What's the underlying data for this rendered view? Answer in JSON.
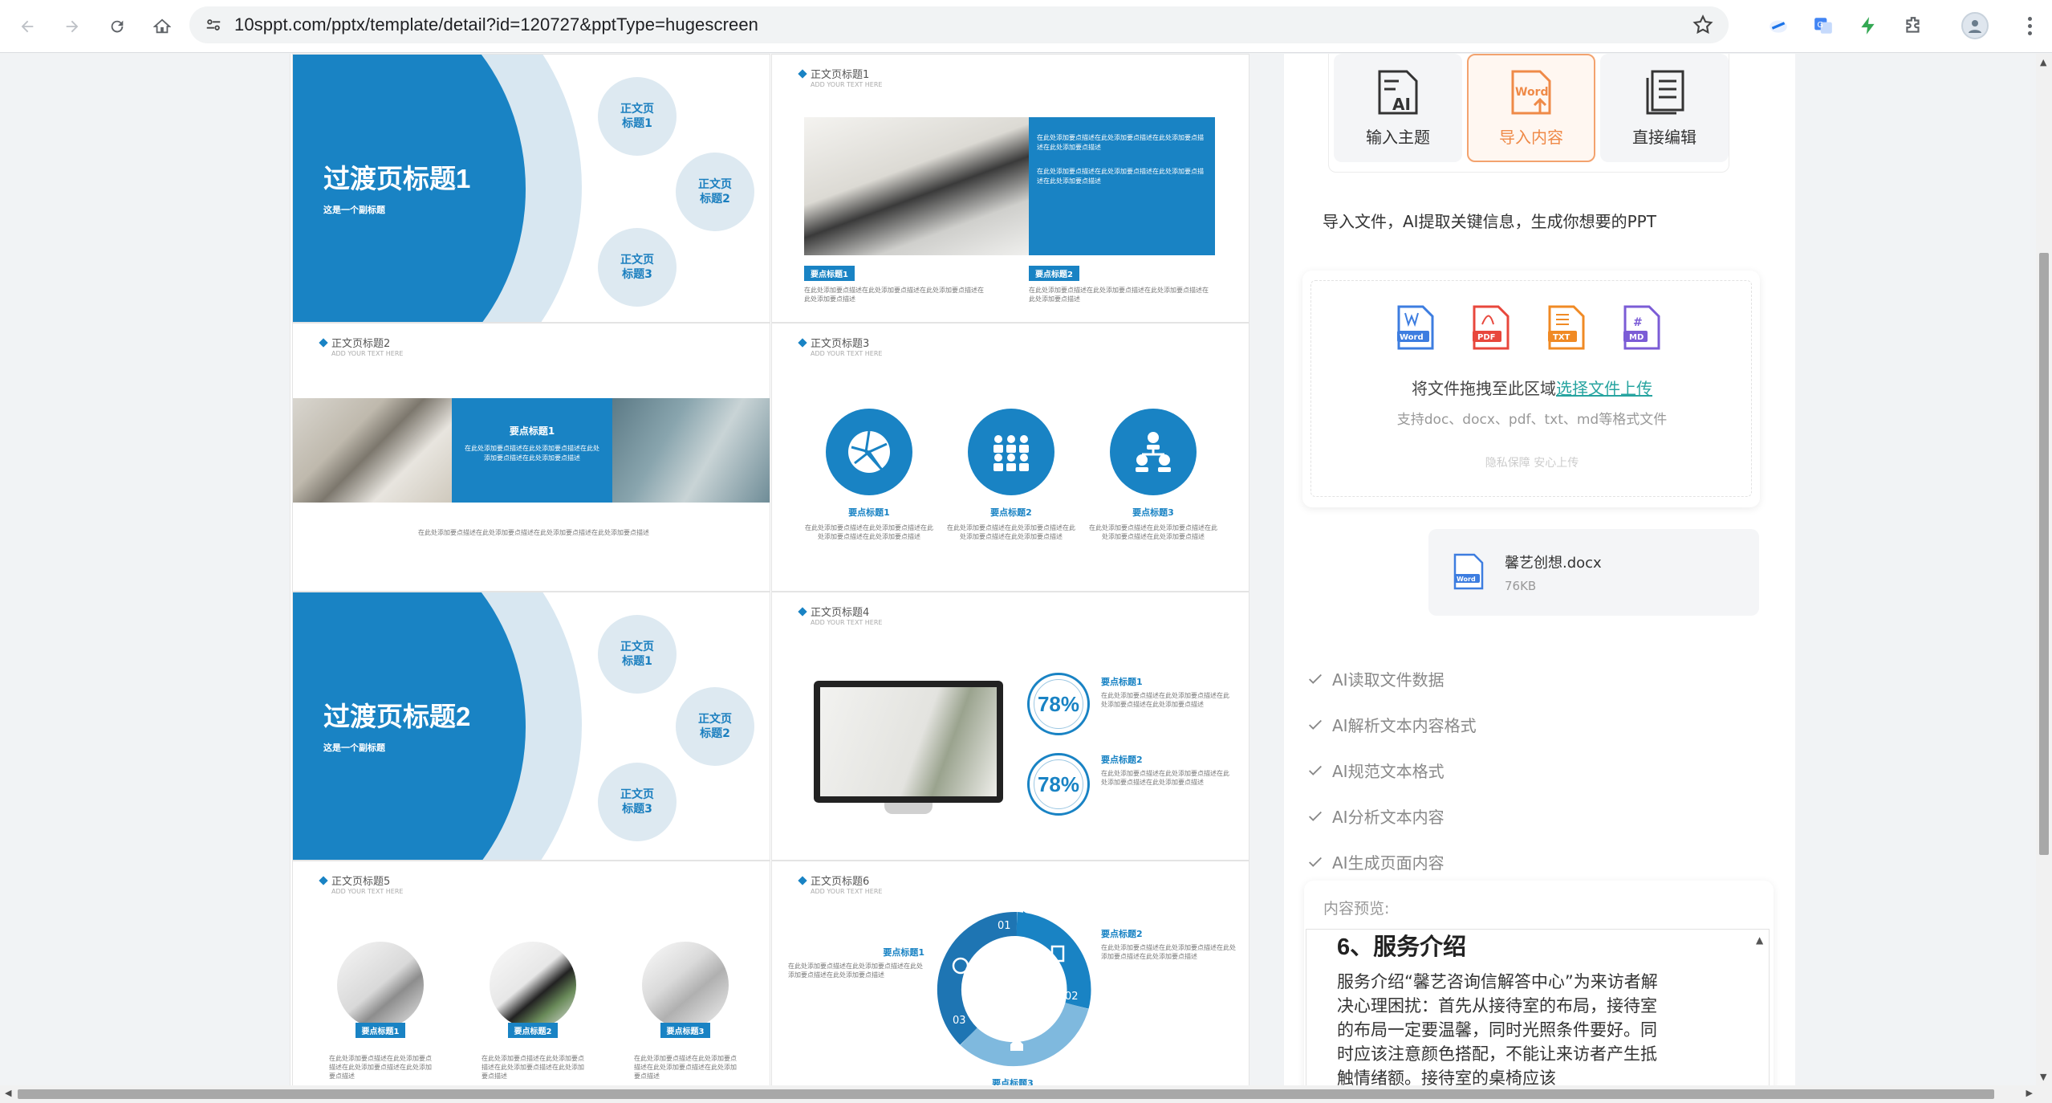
{
  "browser": {
    "url": "10sppt.com/pptx/template/detail?id=120727&pptType=hugescreen"
  },
  "slides": {
    "transition1": {
      "title": "过渡页标题1",
      "subtitle": "这是一个副标题",
      "bubbles": [
        "正文页\n标题1",
        "正文页\n标题2",
        "正文页\n标题3"
      ]
    },
    "transition2": {
      "title": "过渡页标题2",
      "subtitle": "这是一个副标题",
      "bubbles": [
        "正文页\n标题1",
        "正文页\n标题2",
        "正文页\n标题3"
      ]
    },
    "subhead": "ADD YOUR TEXT HERE",
    "body1": {
      "heading": "正文页标题1",
      "tag1": "要点标题1",
      "tag2": "要点标题2"
    },
    "body2": {
      "heading": "正文页标题2",
      "tag": "要点标题1"
    },
    "body3": {
      "heading": "正文页标题3",
      "labels": [
        "要点标题1",
        "要点标题2",
        "要点标题3"
      ]
    },
    "body4": {
      "heading": "正文页标题4",
      "pct1": "78%",
      "pct2": "78%",
      "tag1": "要点标题1",
      "tag2": "要点标题2"
    },
    "body5": {
      "heading": "正文页标题5",
      "labels": [
        "要点标题1",
        "要点标题2",
        "要点标题3"
      ]
    },
    "body6": {
      "heading": "正文页标题6",
      "tag1": "要点标题1",
      "tag2": "要点标题2",
      "tag3": "要点标题3",
      "n1": "01",
      "n2": "02",
      "n3": "03"
    },
    "filler": "在此处添加要点描述在此处添加要点描述在此处添加要点描述在此处添加要点描述"
  },
  "panel": {
    "modes": [
      {
        "label": "输入主题",
        "icon": "ai-document-icon"
      },
      {
        "label": "导入内容",
        "icon": "word-import-icon",
        "active": true
      },
      {
        "label": "直接编辑",
        "icon": "edit-document-icon"
      }
    ],
    "hint": "导入文件，AI提取关键信息，生成你想要的PPT",
    "drop": {
      "text": "将文件拖拽至此区域",
      "link": "选择文件上传",
      "support": "支持doc、docx、pdf、txt、md等格式文件",
      "privacy": "隐私保障 安心上传",
      "types": [
        "Word",
        "PDF",
        "TXT",
        "MD"
      ]
    },
    "file": {
      "name": "馨艺创想.docx",
      "size": "76KB"
    },
    "steps": [
      "AI读取文件数据",
      "AI解析文本内容格式",
      "AI规范文本格式",
      "AI分析文本内容",
      "AI生成页面内容"
    ],
    "preview": {
      "label": "内容预览:",
      "title": "6、服务介绍",
      "body": "服务介绍“馨艺咨询信解答中心”为来访者解决心理困扰：首先从接待室的布局，接待室的布局一定要温馨，同时光照条件要好。同时应该注意颜色搭配，不能让来访者产生抵触情绪额。接待室的桌椅应该"
    }
  },
  "colors": {
    "accent": "#1983c4",
    "orange": "#ef8a48",
    "link": "#27a4a0"
  }
}
